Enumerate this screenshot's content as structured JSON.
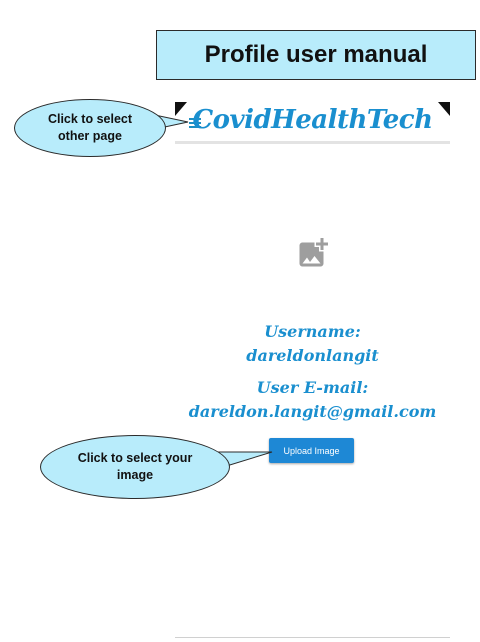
{
  "manual": {
    "title": "Profile user manual"
  },
  "app_header": {
    "brand": "CovidHealthTech",
    "menu_icon": "hamburger-menu-icon"
  },
  "profile": {
    "image_placeholder_icon": "add-photo-icon",
    "username_label": "Username:",
    "username_value": "dareldonlangit",
    "email_label": "User E-mail:",
    "email_value": "dareldon.langit@gmail.com",
    "upload_button_label": "Upload Image"
  },
  "callouts": {
    "menu": "Click to select other page",
    "upload": "Click to select your image"
  },
  "colors": {
    "callout_fill": "#b8ecfb",
    "brand_blue": "#1a8fcf",
    "button_blue": "#1e88d5",
    "icon_grey": "#9e9e9e"
  }
}
